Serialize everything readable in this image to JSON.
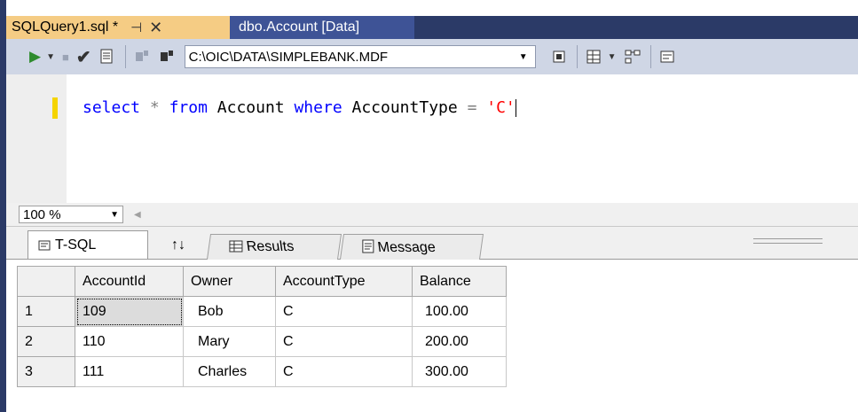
{
  "tabs": {
    "active_label": "SQLQuery1.sql *",
    "pin_glyph": "⊣",
    "close_glyph": "✕",
    "inactive_label": "dbo.Account [Data]"
  },
  "toolbar": {
    "database_path": "C:\\OIC\\DATA\\SIMPLEBANK.MDF"
  },
  "editor": {
    "kw_select": "select",
    "op_star": "*",
    "kw_from": "from",
    "ident_table": "Account",
    "kw_where": "where",
    "ident_column": "AccountType",
    "op_eq": "=",
    "str_value": "'C'"
  },
  "zoom": {
    "value": "100 %"
  },
  "result_tabs": {
    "tsql_label": "T-SQL",
    "sort_glyph": "↑↓",
    "results_label": "Results",
    "message_label": "Message"
  },
  "grid": {
    "columns": [
      "AccountId",
      "Owner",
      "AccountType",
      "Balance"
    ],
    "rows": [
      {
        "num": "1",
        "cells": [
          "109",
          "Bob",
          "C",
          "100.00"
        ]
      },
      {
        "num": "2",
        "cells": [
          "110",
          "Mary",
          "C",
          "200.00"
        ]
      },
      {
        "num": "3",
        "cells": [
          "111",
          "Charles",
          "C",
          "300.00"
        ]
      }
    ]
  },
  "colors": {
    "frame": "#2b3a67",
    "active_tab": "#f5cc84",
    "keyword": "#0000ff",
    "string": "#ff0000"
  },
  "icons": [
    "pin-icon",
    "close-icon",
    "execute-icon",
    "stop-icon",
    "parse-check-icon",
    "results-to-grid-icon",
    "database-icon",
    "toolbar-grid-icon",
    "sort-icon",
    "results-grid-icon",
    "message-icon"
  ]
}
